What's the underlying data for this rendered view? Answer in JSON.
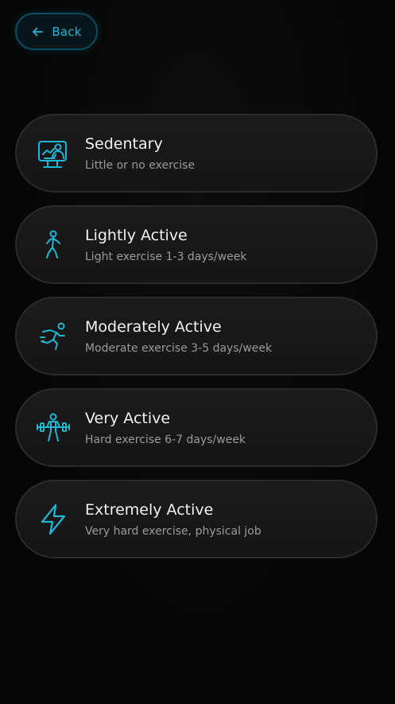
{
  "header": {
    "back_label": "Back"
  },
  "colors": {
    "accent": "#1fb7d6",
    "card_bg": "#181818",
    "card_border": "#2b2b2b",
    "title": "#f2f2f2",
    "subtitle": "#9a9a9a"
  },
  "options": [
    {
      "title": "Sedentary",
      "description": "Little or no exercise",
      "icon": "desk-person-icon"
    },
    {
      "title": "Lightly Active",
      "description": "Light exercise 1-3 days/week",
      "icon": "walking-icon"
    },
    {
      "title": "Moderately Active",
      "description": "Moderate exercise 3-5 days/week",
      "icon": "running-icon"
    },
    {
      "title": "Very Active",
      "description": "Hard exercise 6-7 days/week",
      "icon": "weightlifting-icon"
    },
    {
      "title": "Extremely Active",
      "description": "Very hard exercise, physical job",
      "icon": "lightning-icon"
    }
  ]
}
